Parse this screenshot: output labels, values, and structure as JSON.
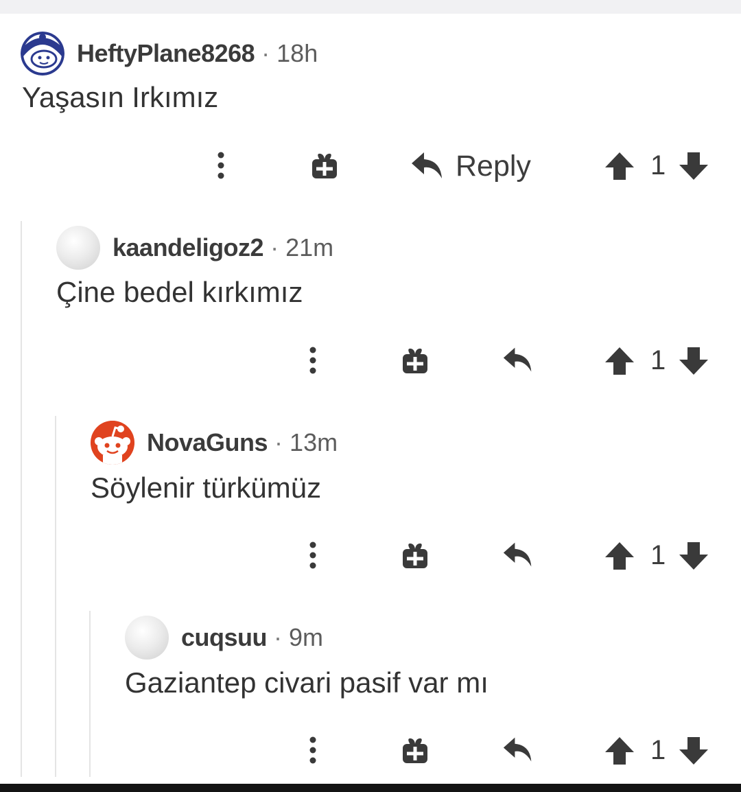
{
  "comments": [
    {
      "username": "HeftyPlane8268",
      "separator": "·",
      "time": "18h",
      "body": "Yaşasın Irkımız",
      "avatar": "snoo-blue-avatar",
      "score": "1",
      "reply_label": "Reply"
    },
    {
      "username": "kaandeligoz2",
      "separator": "·",
      "time": "21m",
      "body": "Çine bedel kırkımız",
      "avatar": "default-gray-avatar",
      "score": "1"
    },
    {
      "username": "NovaGuns",
      "separator": "·",
      "time": "13m",
      "body": "Söylenir türkümüz",
      "avatar": "snoo-orange-avatar",
      "score": "1"
    },
    {
      "username": "cuqsuu",
      "separator": "·",
      "time": "9m",
      "body": "Gaziantep civari pasif var mı",
      "avatar": "default-gray-avatar",
      "score": "1"
    }
  ],
  "icons": {
    "more": "more-options-icon",
    "award": "gift-award-icon",
    "reply": "reply-arrow-icon",
    "upvote": "upvote-arrow-icon",
    "downvote": "downvote-arrow-icon"
  },
  "colors": {
    "text": "#333333",
    "meta": "#5c5c5c",
    "icon": "#3a3a3a",
    "thread_line": "#e4e4e4",
    "orange_avatar": "#e0431f",
    "blue_avatar": "#2b3a8f"
  }
}
